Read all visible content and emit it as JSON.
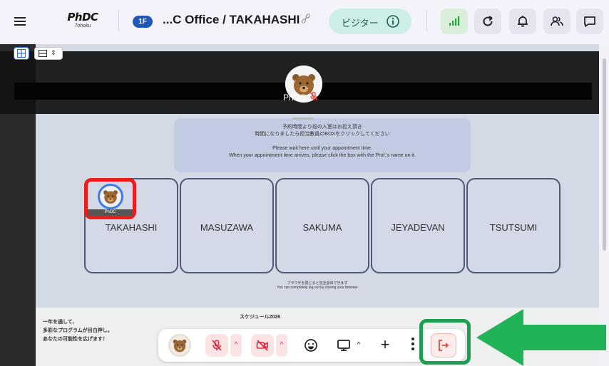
{
  "app": {
    "logo_main": "PhDC",
    "logo_sub": "Tohoku",
    "floor_badge": "1F",
    "room_title": "...C Office / TAKAHASHI",
    "visitor_label": "ビジター"
  },
  "toolbar": {
    "buttons": [
      "hamburger-menu-icon",
      "link-icon",
      "info-icon",
      "signal-icon",
      "reload-icon",
      "bell-icon",
      "people-icon",
      "chat-icon"
    ]
  },
  "view": {
    "list_updown": "⇕"
  },
  "overlay": {
    "self_name": "PhDC"
  },
  "content": {
    "notice_jp_1": "予約時間より前の入室はお控え頂き",
    "notice_jp_2": "時間になりましたら担当教員のBOXをクリックしてください",
    "notice_en_1": "Please wait here until your appointment time.",
    "notice_en_2": "When your appointment time arrives, please click the box with the Prof.'s name on it.",
    "tiles": [
      "TAKAHASHI",
      "MASUZAWA",
      "SAKUMA",
      "JEYADEVAN",
      "TSUTSUMI"
    ],
    "note_jp": "ブラウザを閉じると完全退出できます",
    "note_en": "You can completely log out by closing your browser",
    "schedule_title": "スケジュール2026",
    "promo_1": "一年を通して、",
    "promo_2": "多彩なプログラムが目白押し。",
    "promo_3": "あなたの可能性を広げます！"
  },
  "highlight": {
    "avatar_label": "PhDC"
  },
  "controls": {
    "caret_up": "^",
    "plus": "+"
  },
  "colors": {
    "accent_blue": "#1f57b8",
    "highlight_red": "#ee1b1b",
    "highlight_green": "#1e9e51",
    "visitor_pill": "#cdeee9"
  }
}
